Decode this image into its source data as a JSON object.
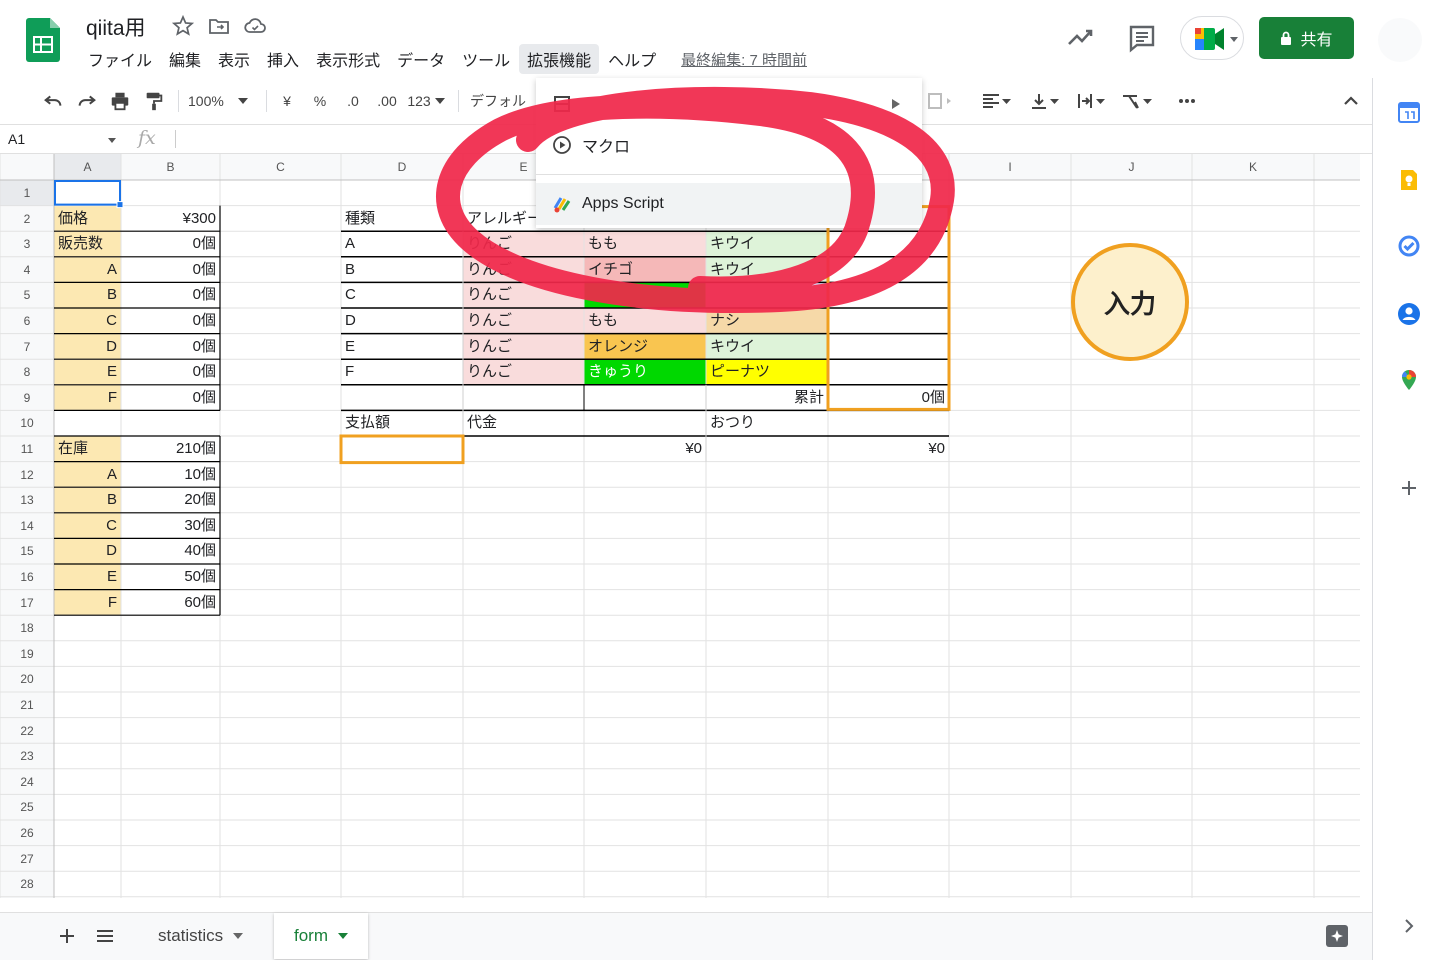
{
  "header": {
    "doc_title": "qiita用",
    "last_edit": "最終編集: 7 時間前",
    "share_label": "共有"
  },
  "menus": [
    {
      "label": "ファイル"
    },
    {
      "label": "編集"
    },
    {
      "label": "表示"
    },
    {
      "label": "挿入"
    },
    {
      "label": "表示形式"
    },
    {
      "label": "データ"
    },
    {
      "label": "ツール"
    },
    {
      "label": "拡張機能",
      "active": true
    },
    {
      "label": "ヘルプ"
    }
  ],
  "toolbar": {
    "zoom": "100%",
    "currency": "¥",
    "percent": "%",
    "dec_decrease": ".0",
    "dec_increase": ".00",
    "format": "123",
    "font": "デフォル"
  },
  "formula_bar": {
    "name_box": "A1",
    "fx": "fx"
  },
  "extensions_menu": {
    "items": [
      {
        "label": "マクロ",
        "icon": "play-circle-icon"
      },
      {
        "label": "Apps Script",
        "icon": "apps-script-icon"
      }
    ]
  },
  "grid": {
    "columns": [
      "A",
      "B",
      "C",
      "D",
      "E",
      "F",
      "G",
      "H",
      "I",
      "J",
      "K"
    ],
    "rows": [
      "1",
      "2",
      "3",
      "4",
      "5",
      "6",
      "7",
      "8",
      "9",
      "10",
      "11",
      "12",
      "13",
      "14",
      "15",
      "16",
      "17",
      "18",
      "19",
      "20",
      "21",
      "22",
      "23",
      "24",
      "25",
      "26",
      "27",
      "28"
    ],
    "selected_cell": "A1",
    "cells": [
      {
        "ref": "A2",
        "text": "価格",
        "bg": "#fce8b2"
      },
      {
        "ref": "B2",
        "text": "¥300",
        "align": "right"
      },
      {
        "ref": "A3",
        "text": "販売数",
        "bg": "#fce8b2"
      },
      {
        "ref": "B3",
        "text": "0個",
        "align": "right"
      },
      {
        "ref": "A4",
        "text": "A",
        "align": "right",
        "bg": "#fce8b2"
      },
      {
        "ref": "B4",
        "text": "0個",
        "align": "right"
      },
      {
        "ref": "A5",
        "text": "B",
        "align": "right",
        "bg": "#fce8b2"
      },
      {
        "ref": "B5",
        "text": "0個",
        "align": "right"
      },
      {
        "ref": "A6",
        "text": "C",
        "align": "right",
        "bg": "#fce8b2"
      },
      {
        "ref": "B6",
        "text": "0個",
        "align": "right"
      },
      {
        "ref": "A7",
        "text": "D",
        "align": "right",
        "bg": "#fce8b2"
      },
      {
        "ref": "B7",
        "text": "0個",
        "align": "right"
      },
      {
        "ref": "A8",
        "text": "E",
        "align": "right",
        "bg": "#fce8b2"
      },
      {
        "ref": "B8",
        "text": "0個",
        "align": "right"
      },
      {
        "ref": "A9",
        "text": "F",
        "align": "right",
        "bg": "#fce8b2"
      },
      {
        "ref": "B9",
        "text": "0個",
        "align": "right"
      },
      {
        "ref": "A11",
        "text": "在庫",
        "bg": "#fce8b2"
      },
      {
        "ref": "B11",
        "text": "210個",
        "align": "right"
      },
      {
        "ref": "A12",
        "text": "A",
        "align": "right",
        "bg": "#fce8b2"
      },
      {
        "ref": "B12",
        "text": "10個",
        "align": "right"
      },
      {
        "ref": "A13",
        "text": "B",
        "align": "right",
        "bg": "#fce8b2"
      },
      {
        "ref": "B13",
        "text": "20個",
        "align": "right"
      },
      {
        "ref": "A14",
        "text": "C",
        "align": "right",
        "bg": "#fce8b2"
      },
      {
        "ref": "B14",
        "text": "30個",
        "align": "right"
      },
      {
        "ref": "A15",
        "text": "D",
        "align": "right",
        "bg": "#fce8b2"
      },
      {
        "ref": "B15",
        "text": "40個",
        "align": "right"
      },
      {
        "ref": "A16",
        "text": "E",
        "align": "right",
        "bg": "#fce8b2"
      },
      {
        "ref": "B16",
        "text": "50個",
        "align": "right"
      },
      {
        "ref": "A17",
        "text": "F",
        "align": "right",
        "bg": "#fce8b2"
      },
      {
        "ref": "B17",
        "text": "60個",
        "align": "right"
      },
      {
        "ref": "D2",
        "text": "種類"
      },
      {
        "ref": "E2",
        "text": "アレルギー"
      },
      {
        "ref": "D3",
        "text": "A"
      },
      {
        "ref": "E3",
        "text": "りんご",
        "bg": "#f9dcdc"
      },
      {
        "ref": "F3",
        "text": "もも",
        "bg": "#f9dcdc"
      },
      {
        "ref": "G3",
        "text": "キウイ",
        "bg": "#def3d9"
      },
      {
        "ref": "D4",
        "text": "B"
      },
      {
        "ref": "E4",
        "text": "りんご",
        "bg": "#f9dcdc"
      },
      {
        "ref": "F4",
        "text": "イチゴ",
        "bg": "#f5b8b8"
      },
      {
        "ref": "G4",
        "text": "キウイ",
        "bg": "#def3d9"
      },
      {
        "ref": "D5",
        "text": "C"
      },
      {
        "ref": "E5",
        "text": "りんご",
        "bg": "#f9dcdc"
      },
      {
        "ref": "F5",
        "text": "",
        "bg": "#00d800"
      },
      {
        "ref": "G5",
        "text": "",
        "bg": "#d9d2f0"
      },
      {
        "ref": "D6",
        "text": "D"
      },
      {
        "ref": "E6",
        "text": "りんご",
        "bg": "#f9dcdc"
      },
      {
        "ref": "F6",
        "text": "もも",
        "bg": "#f9dcdc"
      },
      {
        "ref": "G6",
        "text": "ナシ",
        "bg": "#f6d9a8"
      },
      {
        "ref": "D7",
        "text": "E"
      },
      {
        "ref": "E7",
        "text": "りんご",
        "bg": "#f9dcdc"
      },
      {
        "ref": "F7",
        "text": "オレンジ",
        "bg": "#f9c550"
      },
      {
        "ref": "G7",
        "text": "キウイ",
        "bg": "#def3d9"
      },
      {
        "ref": "D8",
        "text": "F"
      },
      {
        "ref": "E8",
        "text": "りんご",
        "bg": "#f9dcdc"
      },
      {
        "ref": "F8",
        "text": "きゅうり",
        "bg": "#00d800",
        "color": "#ffffff"
      },
      {
        "ref": "G8",
        "text": "ピーナツ",
        "bg": "#ffff00"
      },
      {
        "ref": "G9",
        "text": "累計",
        "align": "right"
      },
      {
        "ref": "H9",
        "text": "0個",
        "align": "right"
      },
      {
        "ref": "D10",
        "text": "支払額"
      },
      {
        "ref": "E10",
        "text": "代金"
      },
      {
        "ref": "G10",
        "text": "おつり"
      },
      {
        "ref": "F11",
        "text": "¥0",
        "align": "right"
      },
      {
        "ref": "H11",
        "text": "¥0",
        "align": "right"
      }
    ]
  },
  "annotation": {
    "badge_text": "入力",
    "badge_color": "#f0a020",
    "scribble_color": "#f0284a"
  },
  "side_panel": {
    "icons": [
      "calendar-icon",
      "keep-icon",
      "tasks-icon",
      "contacts-icon",
      "maps-icon",
      "add-icon"
    ]
  },
  "tabs": {
    "sheets": [
      {
        "label": "statistics",
        "active": false
      },
      {
        "label": "form",
        "active": true
      }
    ]
  },
  "colors": {
    "accent": "#188038",
    "selection": "#1a73e8",
    "header_bg": "#f8f9fa"
  }
}
